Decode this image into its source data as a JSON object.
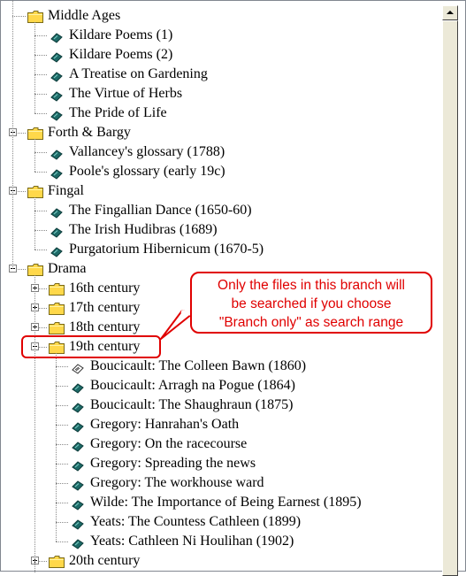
{
  "tree": [
    {
      "label": "Middle Ages",
      "type": "folder",
      "depth": 0,
      "expander": "none",
      "lead": "corner"
    },
    {
      "label": "Kildare Poems (1)",
      "type": "doc",
      "depth": 1
    },
    {
      "label": "Kildare Poems (2)",
      "type": "doc",
      "depth": 1
    },
    {
      "label": "A Treatise on Gardening",
      "type": "doc",
      "depth": 1
    },
    {
      "label": "The Virtue of Herbs",
      "type": "doc",
      "depth": 1
    },
    {
      "label": "The Pride of Life",
      "type": "doc",
      "depth": 1
    },
    {
      "label": "Forth & Bargy",
      "type": "folder",
      "depth": 0,
      "expander": "minus"
    },
    {
      "label": "Vallancey's glossary (1788)",
      "type": "doc",
      "depth": 1
    },
    {
      "label": "Poole's glossary (early 19c)",
      "type": "doc",
      "depth": 1
    },
    {
      "label": "Fingal",
      "type": "folder",
      "depth": 0,
      "expander": "minus"
    },
    {
      "label": "The Fingallian Dance (1650-60)",
      "type": "doc",
      "depth": 1
    },
    {
      "label": "The Irish Hudibras (1689)",
      "type": "doc",
      "depth": 1
    },
    {
      "label": "Purgatorium Hibernicum (1670-5)",
      "type": "doc",
      "depth": 1
    },
    {
      "label": "Drama",
      "type": "folder",
      "depth": 0,
      "expander": "minus"
    },
    {
      "label": "16th century",
      "type": "folder",
      "depth": 1,
      "expander": "plus"
    },
    {
      "label": "17th century",
      "type": "folder",
      "depth": 1,
      "expander": "plus"
    },
    {
      "label": "18th century",
      "type": "folder",
      "depth": 1,
      "expander": "plus"
    },
    {
      "label": "19th century",
      "type": "folder",
      "depth": 1,
      "expander": "minus"
    },
    {
      "label": "Boucicault: The Colleen Bawn (1860)",
      "type": "doc-open",
      "depth": 2
    },
    {
      "label": "Boucicault: Arragh na Pogue (1864)",
      "type": "doc",
      "depth": 2
    },
    {
      "label": "Boucicault: The Shaughraun (1875)",
      "type": "doc",
      "depth": 2
    },
    {
      "label": "Gregory: Hanrahan's Oath",
      "type": "doc",
      "depth": 2
    },
    {
      "label": "Gregory: On the racecourse",
      "type": "doc",
      "depth": 2
    },
    {
      "label": "Gregory: Spreading the news",
      "type": "doc",
      "depth": 2
    },
    {
      "label": "Gregory: The workhouse ward",
      "type": "doc",
      "depth": 2
    },
    {
      "label": "Wilde: The Importance of Being Earnest (1895)",
      "type": "doc",
      "depth": 2
    },
    {
      "label": "Yeats: The Countess Cathleen (1899)",
      "type": "doc",
      "depth": 2
    },
    {
      "label": "Yeats: Cathleen Ni Houlihan (1902)",
      "type": "doc",
      "depth": 2
    },
    {
      "label": "20th century",
      "type": "folder",
      "depth": 1,
      "expander": "plus"
    }
  ],
  "callout": {
    "line1": "Only the files in this branch will",
    "line2": "be searched if you choose",
    "line3": "\"Branch only\" as search range"
  },
  "icons": {
    "folder": "folder-icon",
    "doc": "document-icon",
    "doc_open": "open-document-icon",
    "expand": "expand-plus-icon",
    "collapse": "collapse-minus-icon",
    "scroll_up": "scroll-up-arrow-icon"
  },
  "colors": {
    "folder": "#ffd84a",
    "doc": "#1d6a67",
    "callout": "#e00000",
    "line": "#8a8a8a"
  }
}
